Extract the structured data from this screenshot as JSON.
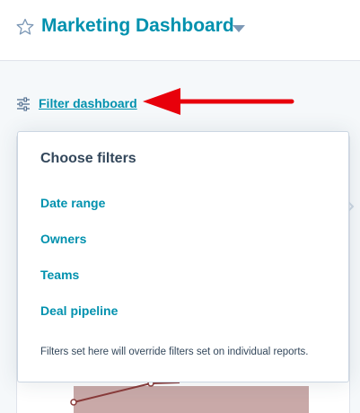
{
  "header": {
    "title": "Marketing Dashboard",
    "star_icon": "star-outline-icon",
    "caret_icon": "caret-down-icon"
  },
  "filter": {
    "icon": "sliders-icon",
    "link_label": "Filter dashboard"
  },
  "popover": {
    "title": "Choose filters",
    "options": [
      "Date range",
      "Owners",
      "Teams",
      "Deal pipeline"
    ],
    "note": "Filters set here will override filters set on individual reports."
  },
  "colors": {
    "link": "#0091ae",
    "text": "#33475b",
    "annotation_arrow": "#e8000b"
  }
}
